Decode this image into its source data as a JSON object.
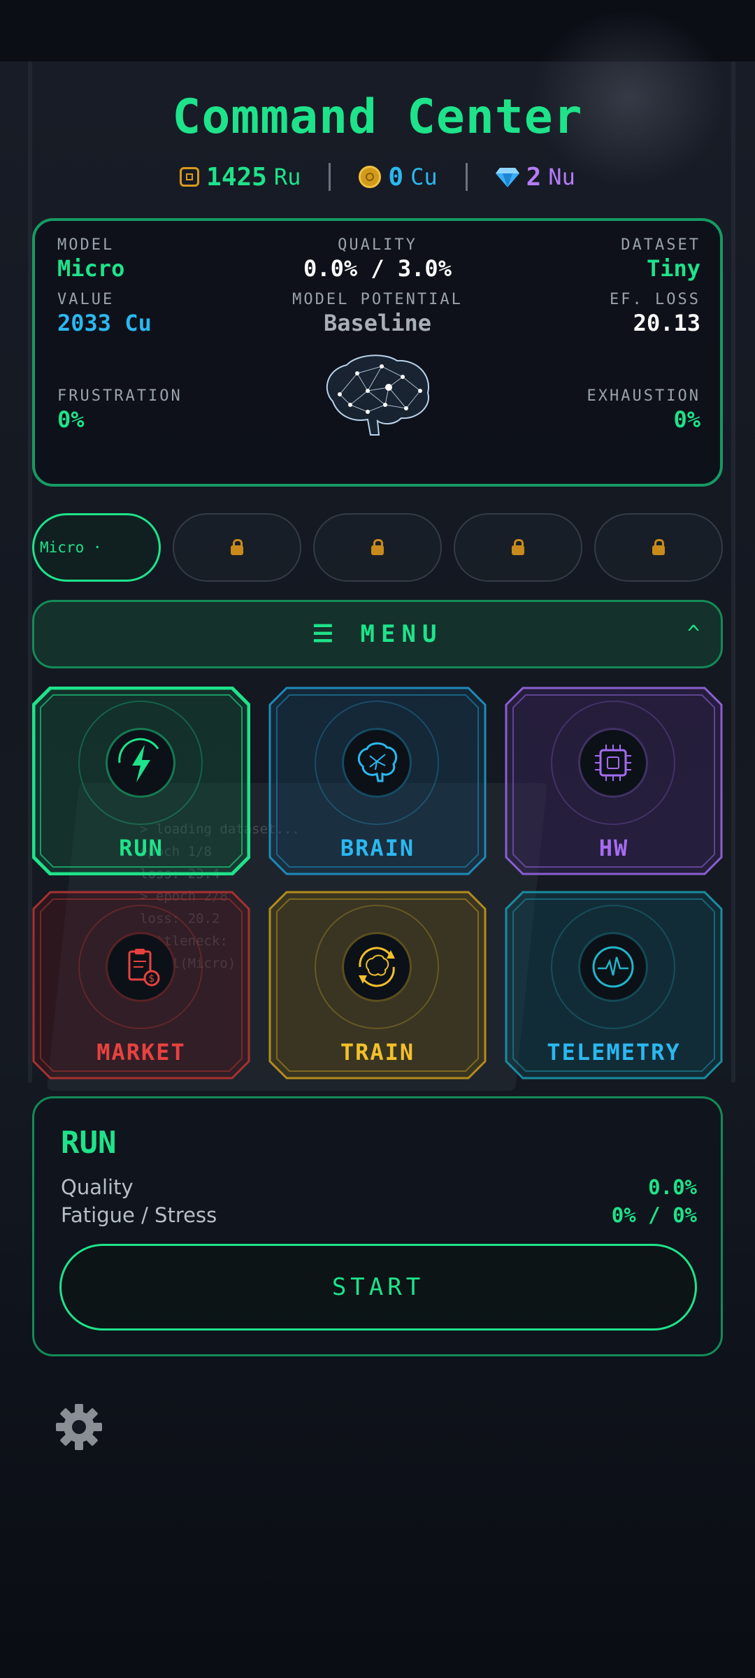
{
  "header": {
    "title": "Command Center"
  },
  "currencies": [
    {
      "icon": "chip-icon",
      "amount": "1425",
      "unit": "Ru",
      "color": "#1ee38a"
    },
    {
      "icon": "coin-icon",
      "amount": "0",
      "unit": "Cu",
      "color": "#2bb8f0"
    },
    {
      "icon": "gem-icon",
      "amount": "2",
      "unit": "Nu",
      "color": "#b47cf5"
    }
  ],
  "stats": {
    "model": {
      "label": "MODEL",
      "value": "Micro"
    },
    "quality": {
      "label": "QUALITY",
      "value": "0.0% / 3.0%"
    },
    "dataset": {
      "label": "DATASET",
      "value": "Tiny"
    },
    "value": {
      "label": "VALUE",
      "value": "2033 Cu"
    },
    "potential": {
      "label": "MODEL POTENTIAL",
      "value": "Baseline"
    },
    "ef_loss": {
      "label": "EF. LOSS",
      "value": "20.13"
    },
    "frustration": {
      "label": "FRUSTRATION",
      "value": "0%"
    },
    "exhaustion": {
      "label": "EXHAUSTION",
      "value": "0%"
    }
  },
  "model_slots": {
    "active_label": "Micro ·",
    "locked_count": 4
  },
  "menu": {
    "label": "☰ MENU",
    "caret": "^"
  },
  "tiles": [
    {
      "key": "run",
      "label": "RUN",
      "icon": "lightning-icon",
      "color": "#1ee38a",
      "selected": true
    },
    {
      "key": "brain",
      "label": "BRAIN",
      "icon": "brain-icon",
      "color": "#2bb8f0",
      "selected": false
    },
    {
      "key": "hw",
      "label": "HW",
      "icon": "chip-icon",
      "color": "#a56cf0",
      "selected": false
    },
    {
      "key": "market",
      "label": "MARKET",
      "icon": "clipboard-dollar-icon",
      "color": "#e8423f",
      "selected": false
    },
    {
      "key": "train",
      "label": "TRAIN",
      "icon": "brain-cycle-icon",
      "color": "#f2c02a",
      "selected": false
    },
    {
      "key": "telemetry",
      "label": "TELEMETRY",
      "icon": "heartbeat-icon",
      "color": "#22b5c8",
      "selected": false
    }
  ],
  "run_panel": {
    "title": "RUN",
    "rows": [
      {
        "label": "Quality",
        "value": "0.0%"
      },
      {
        "label": "Fatigue / Stress",
        "value": "0% / 0%"
      }
    ],
    "button": "START"
  },
  "background_code": [
    "> loading dataset...",
    "epoch 1/8",
    "loss: 23.4",
    "> epoch 2/8",
    "loss: 20.2",
    "bottleneck:",
    "model(Micro)"
  ]
}
